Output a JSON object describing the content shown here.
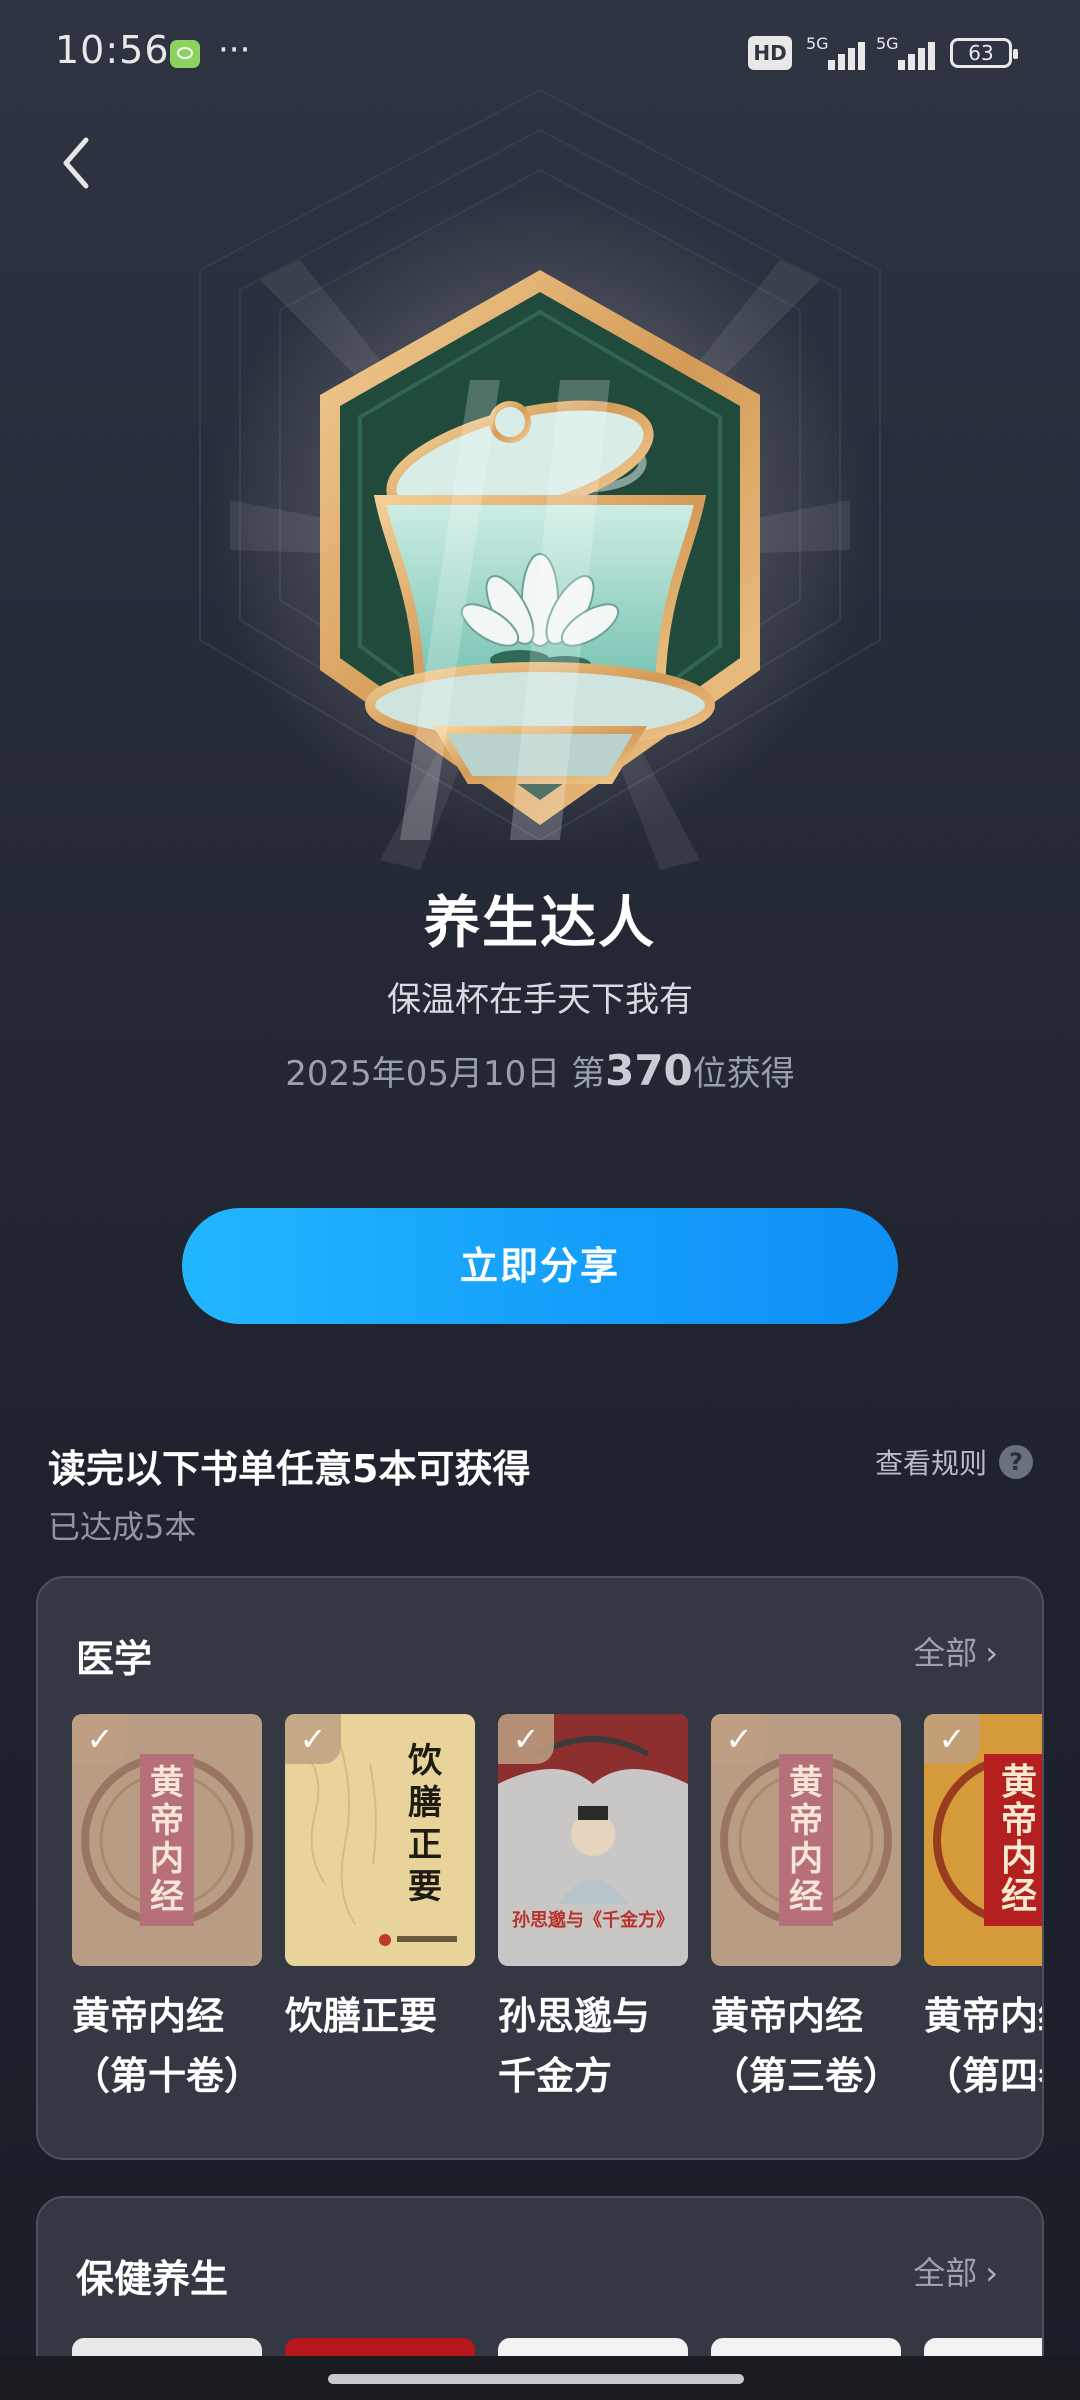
{
  "status_bar": {
    "time": "10:56",
    "more": "···",
    "hd": "HD",
    "network1": "5G",
    "network2": "5G",
    "battery": "63"
  },
  "badge": {
    "title": "养生达人",
    "subtitle": "保温杯在手天下我有",
    "date_prefix": "2025年05月10日 第",
    "rank": "370",
    "date_suffix": "位获得",
    "icon": "lotus-tea-cup-badge"
  },
  "share_button": "立即分享",
  "task": {
    "title": "读完以下书单任意5本可获得",
    "progress": "已达成5本",
    "rules": "查看规则",
    "help": "?"
  },
  "categories": [
    {
      "name": "医学",
      "all": "全部",
      "books": [
        {
          "title": "黄帝内经\n（第十卷）",
          "cover_text": "黄帝内经",
          "completed": true
        },
        {
          "title": "饮膳正要",
          "cover_text": "饮膳正要",
          "completed": true
        },
        {
          "title": "孙思邈与\n千金方",
          "cover_text": "孙思邈与《千金方》",
          "completed": true
        },
        {
          "title": "黄帝内经\n（第三卷）",
          "cover_text": "黄帝内经",
          "completed": true
        },
        {
          "title": "黄帝内经\n（第四卷）",
          "cover_text": "黄帝内经",
          "completed": true
        }
      ]
    },
    {
      "name": "保健养生",
      "all": "全部"
    }
  ],
  "colors": {
    "accent_blue": "#139dfa",
    "badge_gold": "#d8a464",
    "badge_green": "#1f4a3c",
    "card_bg": "#343842"
  }
}
